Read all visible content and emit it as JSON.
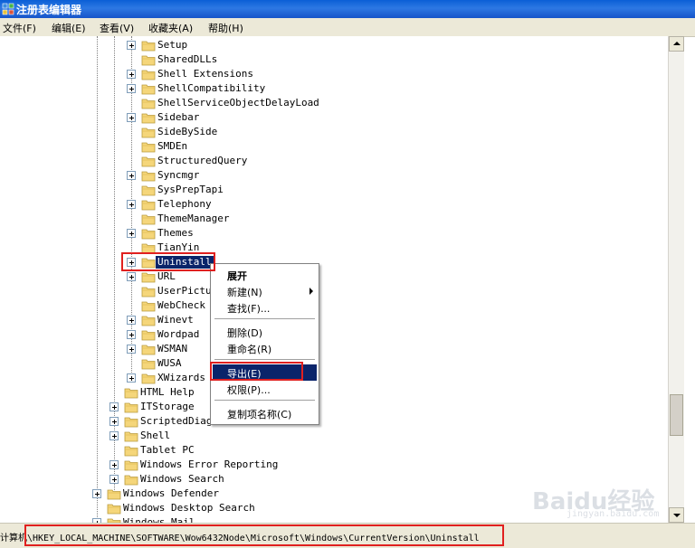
{
  "window": {
    "title": "注册表编辑器",
    "icon": "regedit-icon"
  },
  "menubar": [
    "文件(F)",
    "编辑(E)",
    "查看(V)",
    "收藏夹(A)",
    "帮助(H)"
  ],
  "tree": {
    "level3_items": [
      {
        "label": "Setup",
        "expandable": true
      },
      {
        "label": "SharedDLLs",
        "expandable": false
      },
      {
        "label": "Shell Extensions",
        "expandable": true
      },
      {
        "label": "ShellCompatibility",
        "expandable": true
      },
      {
        "label": "ShellServiceObjectDelayLoad",
        "expandable": false
      },
      {
        "label": "Sidebar",
        "expandable": true
      },
      {
        "label": "SideBySide",
        "expandable": false
      },
      {
        "label": "SMDEn",
        "expandable": false
      },
      {
        "label": "StructuredQuery",
        "expandable": false
      },
      {
        "label": "Syncmgr",
        "expandable": true
      },
      {
        "label": "SysPrepTapi",
        "expandable": false
      },
      {
        "label": "Telephony",
        "expandable": true
      },
      {
        "label": "ThemeManager",
        "expandable": false
      },
      {
        "label": "Themes",
        "expandable": true
      },
      {
        "label": "TianYin",
        "expandable": false
      },
      {
        "label": "Uninstall",
        "expandable": true,
        "selected": true
      },
      {
        "label": "URL",
        "expandable": true
      },
      {
        "label": "UserPictu",
        "expandable": false
      },
      {
        "label": "WebCheck",
        "expandable": false
      },
      {
        "label": "Winevt",
        "expandable": true
      },
      {
        "label": "Wordpad",
        "expandable": true
      },
      {
        "label": "WSMAN",
        "expandable": true
      },
      {
        "label": "WUSA",
        "expandable": false
      },
      {
        "label": "XWizards",
        "expandable": true
      }
    ],
    "level2_items": [
      {
        "label": "HTML Help",
        "expandable": false
      },
      {
        "label": "ITStorage",
        "expandable": true
      },
      {
        "label": "ScriptedDiagnosticsProvider",
        "expandable": true
      },
      {
        "label": "Shell",
        "expandable": true
      },
      {
        "label": "Tablet PC",
        "expandable": false
      },
      {
        "label": "Windows Error Reporting",
        "expandable": true
      },
      {
        "label": "Windows Search",
        "expandable": true
      }
    ],
    "level1_items": [
      {
        "label": "Windows Defender",
        "expandable": true
      },
      {
        "label": "Windows Desktop Search",
        "expandable": false
      },
      {
        "label": "Windows Mail",
        "expandable": true
      }
    ]
  },
  "context_menu": {
    "items": [
      "展开",
      "新建(N)",
      "查找(F)...",
      "删除(D)",
      "重命名(R)",
      "导出(E)",
      "权限(P)...",
      "复制项名称(C)"
    ],
    "highlighted": "导出(E)"
  },
  "status_bar": {
    "path": "计算机\\HKEY_LOCAL_MACHINE\\SOFTWARE\\Wow6432Node\\Microsoft\\Windows\\CurrentVersion\\Uninstall"
  },
  "watermark": {
    "logo": "Baidu经验",
    "url": "jingyan.baidu.com"
  },
  "colors": {
    "selection": "#0a246a",
    "annotation_red": "#e0201f",
    "folder_yellow": "#f5d67a"
  }
}
